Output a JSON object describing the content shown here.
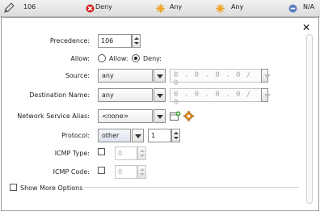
{
  "header": {
    "precedence": "106",
    "action": "Deny",
    "source": "Any",
    "destination": "Any",
    "status": "N/A"
  },
  "form": {
    "precedence_label": "Precedence:",
    "precedence_value": "106",
    "allow_label": "Allow:",
    "allow_option": "Allow:",
    "deny_option": "Deny:",
    "selected_action": "Deny",
    "source_label": "Source:",
    "source_value": "any",
    "source_ip": "0 . 0 . 0 . 0 / 0",
    "destination_label": "Destination Name:",
    "destination_value": "any",
    "destination_ip": "0 . 0 . 0 . 0 / 0",
    "alias_label": "Network Service Alias:",
    "alias_value": "<none>",
    "protocol_label": "Protocol:",
    "protocol_value": "other",
    "protocol_number": "1",
    "icmp_type_label": "ICMP Type:",
    "icmp_type_value": "0",
    "icmp_code_label": "ICMP Code:",
    "icmp_code_value": "0",
    "show_more_label": "Show More Options"
  },
  "icons": {
    "edit": "pencil-icon",
    "deny": "deny-x-icon",
    "any": "starburst-icon",
    "na": "minus-circle-icon",
    "close": "close-icon",
    "add_alias": "add-alias-icon",
    "settings": "gear-icon"
  },
  "colors": {
    "deny_red": "#d42020",
    "any_orange": "#f0a020",
    "na_blue": "#5a7fc0"
  }
}
